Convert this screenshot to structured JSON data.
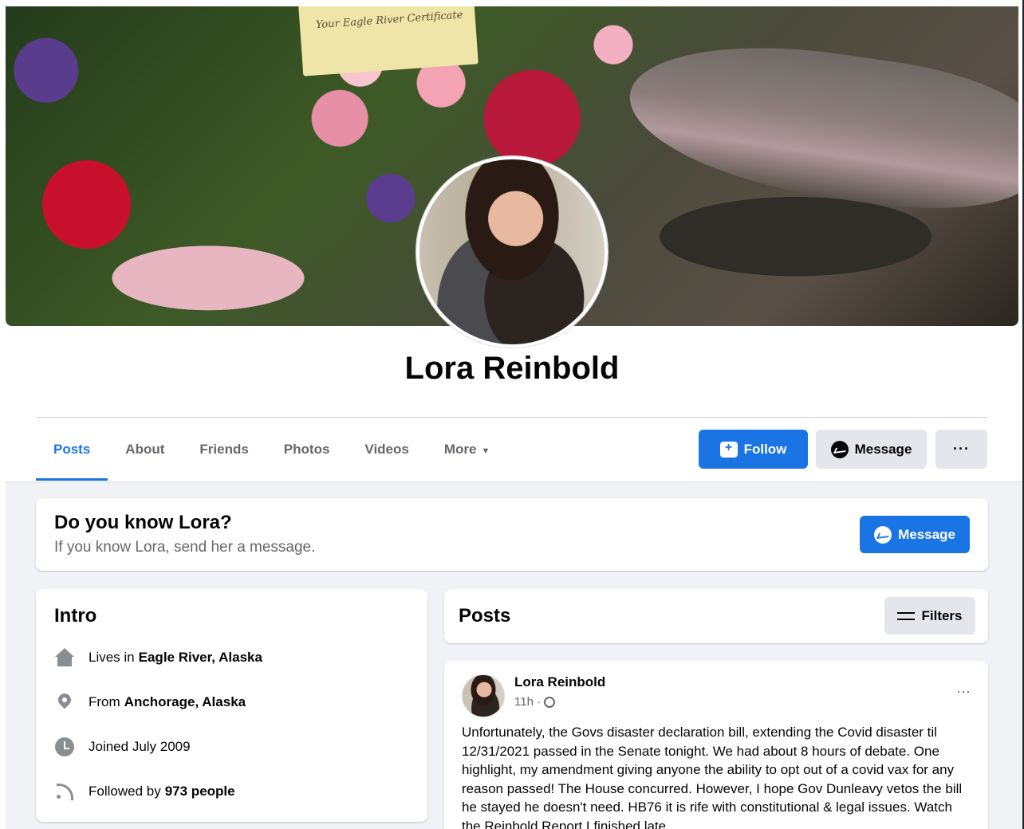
{
  "profile": {
    "name": "Lora Reinbold",
    "cover_card_text": "Your Eagle River Certificate"
  },
  "tabs": [
    {
      "label": "Posts",
      "active": true
    },
    {
      "label": "About"
    },
    {
      "label": "Friends"
    },
    {
      "label": "Photos"
    },
    {
      "label": "Videos"
    },
    {
      "label": "More"
    }
  ],
  "actions": {
    "follow_label": "Follow",
    "message_label": "Message",
    "more_label": "···"
  },
  "know_card": {
    "title": "Do you know Lora?",
    "subtitle": "If you know Lora, send her a message.",
    "button_label": "Message"
  },
  "intro": {
    "title": "Intro",
    "rows": [
      {
        "icon": "home-icon",
        "prefix": "Lives in",
        "value": "Eagle River, Alaska"
      },
      {
        "icon": "location-pin-icon",
        "prefix": "From",
        "value": "Anchorage, Alaska"
      },
      {
        "icon": "clock-icon",
        "prefix": "Joined July 2009",
        "value": ""
      },
      {
        "icon": "rss-icon",
        "prefix": "Followed by",
        "value": "973 people"
      }
    ]
  },
  "posts_header": {
    "title": "Posts",
    "filters_label": "Filters"
  },
  "post": {
    "author": "Lora Reinbold",
    "time": "11h ·",
    "more_label": "···",
    "text": "Unfortunately, the Govs disaster declaration bill, extending the Covid disaster til 12/31/2021 passed in the Senate tonight. We had about 8 hours of debate. One highlight, my amendment giving anyone the ability to opt out of a covid vax for any reason passed! The House concurred. However, I hope Gov Dunleavy vetos the bill he stayed he doesn't need. HB76 it is rife with constitutional & legal issues. Watch the Reinbold Report I finished late"
  },
  "colors": {
    "accent": "#1b74e4",
    "button_grey": "#e4e6eb",
    "page_bg": "#f0f2f5",
    "secondary_text": "#65676b"
  }
}
